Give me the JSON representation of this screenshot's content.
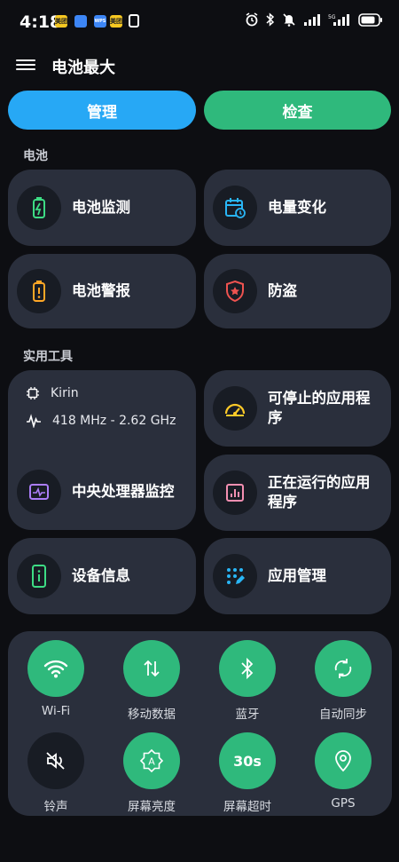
{
  "status": {
    "time": "4:18",
    "notif_icons": [
      "美团",
      "app",
      "WPS",
      "美团"
    ],
    "icons": [
      "alarm-icon",
      "bluetooth-icon",
      "mute-icon",
      "signal-icon",
      "signal-icon",
      "battery-icon"
    ]
  },
  "header": {
    "title": "电池最大"
  },
  "tabs": {
    "manage": "管理",
    "check": "检查"
  },
  "colors": {
    "blue": "#27a8f5",
    "green": "#2fb97c",
    "card": "#2a2f3c",
    "bg": "#0d0e12"
  },
  "battery_section": {
    "label": "电池",
    "items": [
      {
        "label": "电池监测",
        "icon": "battery-charging-icon"
      },
      {
        "label": "电量变化",
        "icon": "calendar-clock-icon"
      },
      {
        "label": "电池警报",
        "icon": "battery-alert-icon"
      },
      {
        "label": "防盗",
        "icon": "shield-star-icon"
      }
    ]
  },
  "tools_section": {
    "label": "实用工具",
    "cpu": {
      "name": "Kirin",
      "freq": "418 MHz - 2.62 GHz",
      "monitor_label": "中央处理器监控"
    },
    "items": [
      {
        "label": "可停止的应用程序",
        "icon": "speedometer-icon"
      },
      {
        "label": "正在运行的应用程序",
        "icon": "bar-chart-icon"
      },
      {
        "label": "设备信息",
        "icon": "phone-info-icon"
      },
      {
        "label": "应用管理",
        "icon": "apps-grid-icon"
      }
    ]
  },
  "quick_settings": [
    {
      "label": "Wi-Fi",
      "icon": "wifi-icon",
      "active": true
    },
    {
      "label": "移动数据",
      "icon": "mobile-data-icon",
      "active": true
    },
    {
      "label": "蓝牙",
      "icon": "bluetooth-icon",
      "active": true
    },
    {
      "label": "自动同步",
      "icon": "sync-icon",
      "active": true
    },
    {
      "label": "铃声",
      "icon": "volume-off-icon",
      "active": false
    },
    {
      "label": "屏幕亮度",
      "icon": "auto-brightness-icon",
      "active": true
    },
    {
      "label": "屏幕超时",
      "icon": "timeout-icon",
      "active": true,
      "value": "30s"
    },
    {
      "label": "GPS",
      "icon": "location-icon",
      "active": true
    }
  ]
}
